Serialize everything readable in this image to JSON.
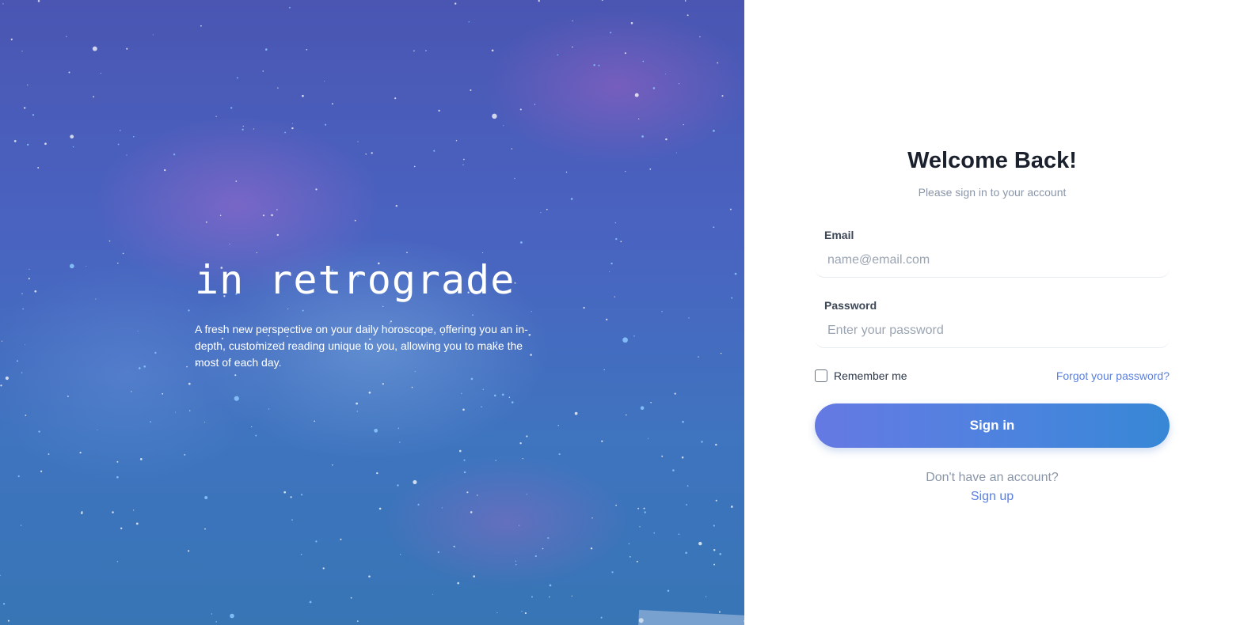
{
  "hero": {
    "title": "in retrograde",
    "description": "A fresh new perspective on your daily horoscope, offering you an in-depth, customized reading unique to you, allowing you to make the most of each day."
  },
  "login": {
    "heading": "Welcome Back!",
    "subtitle": "Please sign in to your account",
    "email": {
      "label": "Email",
      "placeholder": "name@email.com",
      "value": ""
    },
    "password": {
      "label": "Password",
      "placeholder": "Enter your password",
      "value": ""
    },
    "remember_label": "Remember me",
    "remember_checked": false,
    "forgot_label": "Forgot your password?",
    "submit_label": "Sign in",
    "no_account_text": "Don't have an account?",
    "signup_label": "Sign up"
  },
  "colors": {
    "accent": "#5a7fe0",
    "button_gradient_start": "#6579e3",
    "button_gradient_end": "#3787d6",
    "hero_top": "#4a56b2",
    "hero_bottom": "#3775b5"
  },
  "icons": {
    "checkbox": "checkbox-icon"
  }
}
